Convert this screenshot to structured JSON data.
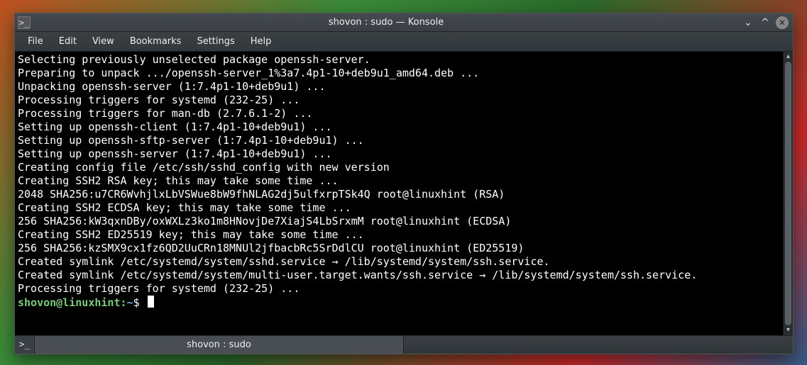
{
  "window": {
    "title": "shovon : sudo — Konsole"
  },
  "menubar": {
    "items": [
      "File",
      "Edit",
      "View",
      "Bookmarks",
      "Settings",
      "Help"
    ]
  },
  "terminal": {
    "lines": [
      "Selecting previously unselected package openssh-server.",
      "Preparing to unpack .../openssh-server_1%3a7.4p1-10+deb9u1_amd64.deb ...",
      "Unpacking openssh-server (1:7.4p1-10+deb9u1) ...",
      "Processing triggers for systemd (232-25) ...",
      "Processing triggers for man-db (2.7.6.1-2) ...",
      "Setting up openssh-client (1:7.4p1-10+deb9u1) ...",
      "Setting up openssh-sftp-server (1:7.4p1-10+deb9u1) ...",
      "Setting up openssh-server (1:7.4p1-10+deb9u1) ...",
      "",
      "Creating config file /etc/ssh/sshd_config with new version",
      "Creating SSH2 RSA key; this may take some time ...",
      "2048 SHA256:u7CR6WvhjlxLbVSWue8bW9fhNLAG2dj5ulfxrpTSk4Q root@linuxhint (RSA)",
      "Creating SSH2 ECDSA key; this may take some time ...",
      "256 SHA256:kW3qxnDBy/oxWXLz3ko1m8HNovjDe7XiajS4LbSrxmM root@linuxhint (ECDSA)",
      "Creating SSH2 ED25519 key; this may take some time ...",
      "256 SHA256:kzSMX9cx1fz6QD2UuCRn18MNUl2jfbacbRc5SrDdlCU root@linuxhint (ED25519)",
      "Created symlink /etc/systemd/system/sshd.service → /lib/systemd/system/ssh.service.",
      "Created symlink /etc/systemd/system/multi-user.target.wants/ssh.service → /lib/systemd/system/ssh.service.",
      "Processing triggers for systemd (232-25) ..."
    ],
    "prompt": {
      "user": "shovon@linuxhint",
      "sep": ":",
      "path": "~",
      "dollar": "$"
    }
  },
  "tabbar": {
    "tabs": [
      "shovon : sudo"
    ]
  },
  "titlebar_icons": {
    "app_glyph": ">_",
    "min_glyph": "⌄",
    "max_glyph": "^",
    "close_glyph": "✕"
  },
  "newtab_glyph": ">_"
}
